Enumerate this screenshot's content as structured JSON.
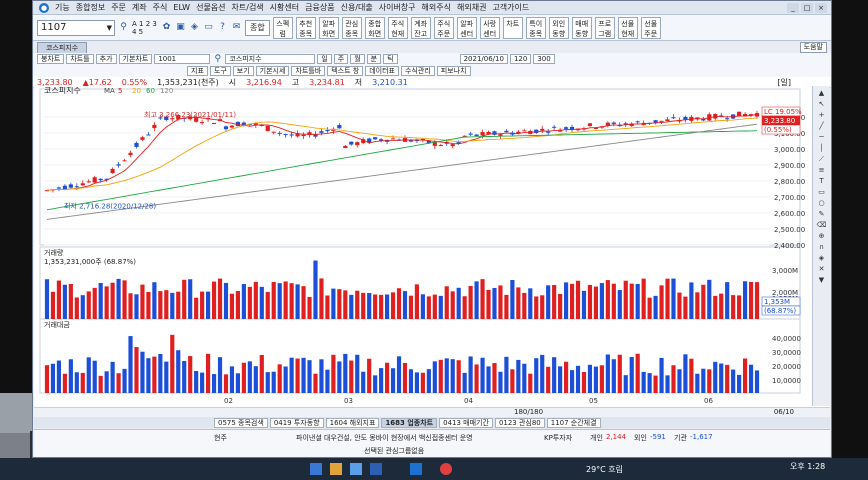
{
  "menu": [
    "기능",
    "종합정보",
    "주문",
    "계좌",
    "주식",
    "ELW",
    "선물옵션",
    "차트/검색",
    "시황센터",
    "금융상품",
    "신용/대출",
    "사이버창구",
    "해외주식",
    "해외채권",
    "고객가이드"
  ],
  "window_controls": [
    "_",
    "□",
    "×"
  ],
  "toolbar": {
    "code_value": "1107",
    "icon_text": "A 1 2 3 4 5",
    "select_value": "종합",
    "quick_buttons": [
      "스펙럼",
      "추천종목",
      "알파화면",
      "관심종목",
      "종합화면",
      "주식현재",
      "계좌잔고",
      "주식주문",
      "알파센터",
      "사랑센터",
      "차트",
      "특이종목",
      "외인동향",
      "매매동향",
      "프로그램",
      "선물현재",
      "선물주문"
    ],
    "help_label": "도움말"
  },
  "tab": {
    "label": "코스피지수",
    "right_label": "도움말"
  },
  "controls": {
    "row1": [
      "봉차트",
      "차트틀",
      "추가",
      "기본차트"
    ],
    "index_code": "1001",
    "index_name": "코스피지수",
    "period_buttons": [
      "일",
      "주",
      "월",
      "분",
      "틱"
    ],
    "date": "2021/06/10",
    "count": "120",
    "count2": "300",
    "row1b": [
      "지표",
      "도구",
      "보기",
      "기본시세",
      "차트틀바",
      "텍스트 창",
      "데이터표",
      "수식관리",
      "피보나치"
    ]
  },
  "info": {
    "price": "3,233.80",
    "change": "▲17.62",
    "change_pct": "0.55%",
    "volume": "1,353,231(천주)",
    "open_label": "시",
    "open": "3,216.94",
    "high_label": "고",
    "high": "3,234.81",
    "low_label": "저",
    "low": "3,210.31",
    "day_label": "[일]"
  },
  "price_panel": {
    "title": "코스피지수",
    "ma_label": "MA",
    "ma": [
      "5",
      "20",
      "60",
      "120"
    ],
    "high_note": "최고 3,266.23(2021/01/11)",
    "low_note": "최저 2,716.28(2020/12/28)",
    "last_tag": [
      "LC 19.05%",
      "3,233.80",
      "(0.55%)"
    ]
  },
  "volume_panel": {
    "title": "거래량",
    "value": "1,353,231,000주 (68.87%)",
    "tag": [
      "1,353M",
      "(68.87%)"
    ]
  },
  "amount_panel": {
    "title": "거래대금"
  },
  "x_axis": {
    "labels": [
      "02",
      "03",
      "04",
      "05",
      "06"
    ],
    "page": "180/180",
    "corner": "06/10"
  },
  "window_tabs": [
    "0575 종목검색",
    "0419 투자동향",
    "1604 해외지표",
    "1683 업종차트",
    "0413 매매기간",
    "0123 관심80",
    "1107 순간체결"
  ],
  "ticker": {
    "left": "현주",
    "news": "파이낸셜 대우건설, 안도 몽바이 현장에서 백신접종센터 운영",
    "kp": "KP투자자",
    "personal_label": "개인",
    "personal": "2,144",
    "foreign_label": "외인",
    "foreign": "-591",
    "inst_label": "기관",
    "inst": "-1,617",
    "bottom": "선택된 관심그룹없음"
  },
  "taskbar": {
    "weather": "29°C 흐림",
    "time": "오후 1:28"
  },
  "chart_data": [
    {
      "type": "candlestick",
      "title": "코스피지수",
      "ylim": [
        2400,
        3300
      ],
      "yticks": [
        2400,
        2500,
        2600,
        2700,
        2800,
        2900,
        3000,
        3100,
        3200
      ],
      "highlight": {
        "high": 3266.23,
        "low": 2716.28,
        "last": 3233.8
      }
    },
    {
      "type": "bar",
      "title": "거래량",
      "yticks": [
        "1,353M",
        "2,000M",
        "3,000M"
      ],
      "ylim": [
        0,
        3500
      ]
    },
    {
      "type": "bar",
      "title": "거래대금",
      "yticks": [
        "10,0000",
        "20,0000",
        "30,0000",
        "40,0000"
      ],
      "ylim": [
        0,
        45000
      ]
    }
  ],
  "colors": {
    "up": "#e02020",
    "down": "#1b4fd8",
    "ma5": "#e02020",
    "ma20": "#f2a20c",
    "ma60": "#1fa840",
    "ma120": "#888888"
  }
}
